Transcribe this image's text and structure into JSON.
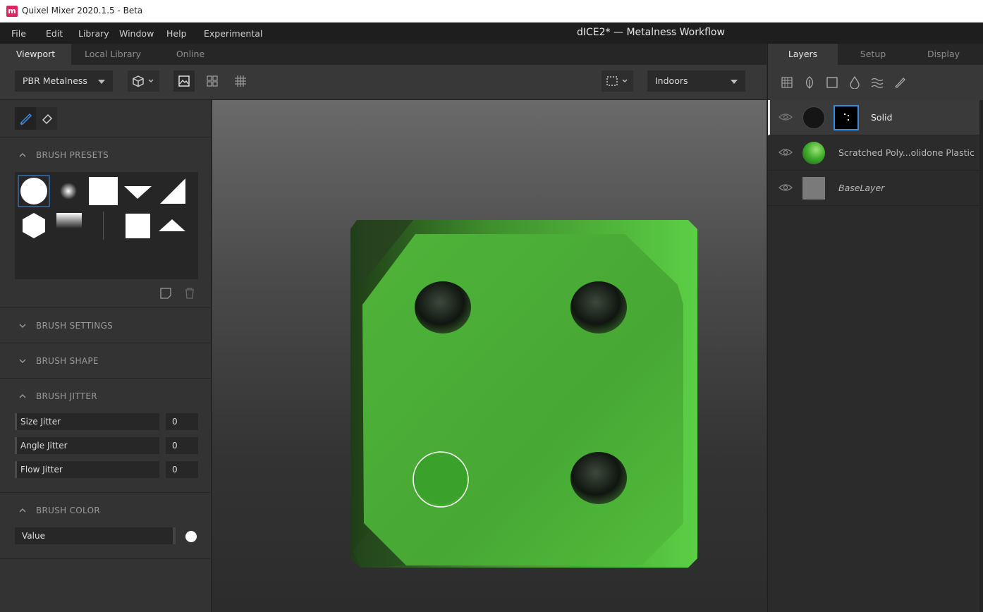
{
  "titlebar": {
    "title": "Quixel Mixer 2020.1.5 - Beta",
    "icon": "m"
  },
  "menubar": {
    "items": [
      "File",
      "Edit",
      "Library",
      "Window",
      "Help",
      "Experimental"
    ],
    "doc_title": "dICE2* — Metalness Workflow"
  },
  "left_tabs": [
    "Viewport",
    "Local Library",
    "Online"
  ],
  "toolbar": {
    "render_mode": "PBR Metalness",
    "environment": "Indoors"
  },
  "brush_panel": {
    "presets_label": "BRUSH PRESETS",
    "settings_label": "BRUSH SETTINGS",
    "shape_label": "BRUSH SHAPE",
    "jitter_label": "BRUSH JITTER",
    "color_label": "BRUSH COLOR",
    "jitter": [
      {
        "name": "Size Jitter",
        "value": "0"
      },
      {
        "name": "Angle Jitter",
        "value": "0"
      },
      {
        "name": "Flow Jitter",
        "value": "0"
      }
    ],
    "color_value_label": "Value"
  },
  "right_tabs": [
    "Layers",
    "Setup",
    "Display"
  ],
  "layers": [
    {
      "name": "Solid"
    },
    {
      "name": "Scratched Poly...olidone Plastic"
    },
    {
      "name": "BaseLayer"
    }
  ],
  "colors": {
    "accent": "#2f7bd8",
    "dice_green": "#4fbf3a",
    "selection": "#4a90e2"
  }
}
